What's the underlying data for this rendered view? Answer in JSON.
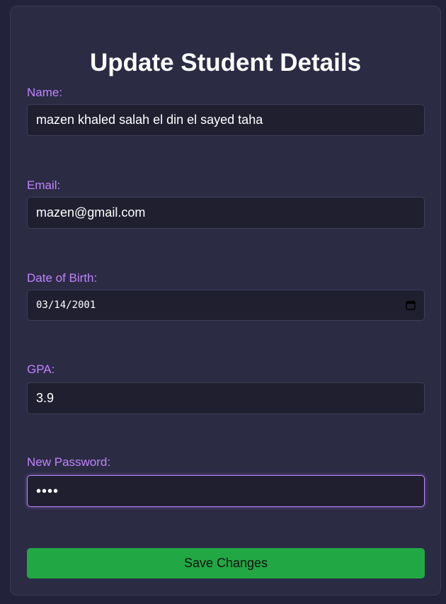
{
  "form": {
    "title": "Update Student Details",
    "fields": {
      "name": {
        "label": "Name:",
        "value": "mazen khaled salah el din el sayed taha"
      },
      "email": {
        "label": "Email:",
        "value": "mazen@gmail.com"
      },
      "dob": {
        "label": "Date of Birth:",
        "value": "03/14/2001"
      },
      "gpa": {
        "label": "GPA:",
        "value": "3.9"
      },
      "password": {
        "label": "New Password:",
        "value": "••••"
      }
    },
    "save_label": "Save Changes"
  },
  "colors": {
    "background": "#22223a",
    "card": "#2b2b44",
    "label": "#c084fc",
    "input_bg": "#1f1f30",
    "button": "#22a745",
    "focus": "#c084fc"
  },
  "icons": {
    "date_picker": "calendar-icon"
  }
}
